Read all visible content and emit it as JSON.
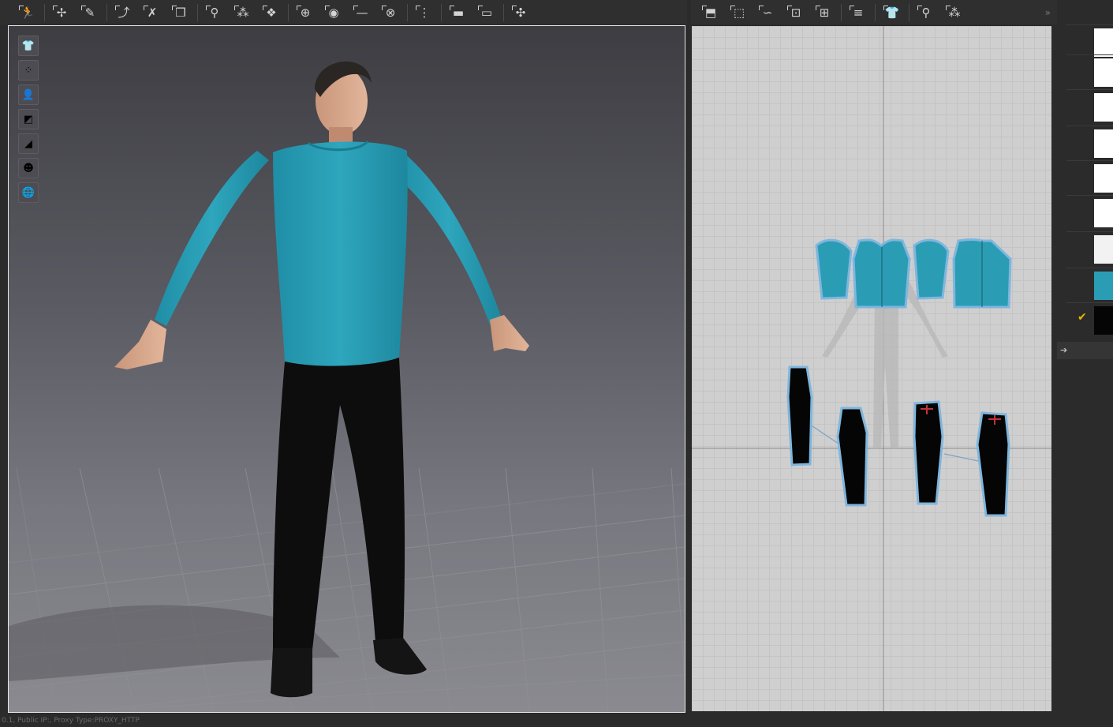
{
  "toolbar3d": {
    "icons": [
      "avatar-pose-icon",
      "move-point-icon",
      "move-edge-icon",
      "tack-icon",
      "tack-remove-icon",
      "fold-icon",
      "pin-icon",
      "select-mesh-icon",
      "strengthen-icon",
      "button-icon",
      "buttonhole-icon",
      "measure-line-icon",
      "lock-icon",
      "zipper-icon",
      "fold-arrange-icon",
      "flat-arrange-icon",
      "reset-icon"
    ]
  },
  "toolbar2d": {
    "icons": [
      "edit-pattern-icon",
      "transform-icon",
      "edit-curve-icon",
      "add-point-icon",
      "segment-sewing-icon",
      "fabric-icon",
      "garment-icon",
      "sewing-free-icon",
      "sewing-pair-icon"
    ],
    "more_glyph": "»"
  },
  "viewport_tools": [
    "garment-display-icon",
    "particle-distance-icon",
    "avatar-display-icon",
    "texture-display-icon",
    "shadow-icon",
    "skin-icon",
    "environment-icon"
  ],
  "swatches": [
    {
      "color": "#ffffff",
      "selected": false
    },
    {
      "color": "#ffffff",
      "selected": false
    },
    {
      "color": "#ffffff",
      "selected": false
    },
    {
      "color": "#ffffff",
      "selected": false
    },
    {
      "color": "#ffffff",
      "selected": false
    },
    {
      "color": "#ffffff",
      "selected": false
    },
    {
      "color": "#f2f2f2",
      "selected": false
    },
    {
      "color": "#2a9db5",
      "selected": false
    },
    {
      "color": "#050505",
      "selected": true
    }
  ],
  "check_glyph": "✔",
  "expander_glyph": "➔",
  "colors": {
    "shirt": "#2a9db5",
    "pants": "#0b0b0b",
    "outline": "#7fb6de"
  },
  "status": "0.1, Public IP:, Proxy Type:PROXY_HTTP"
}
